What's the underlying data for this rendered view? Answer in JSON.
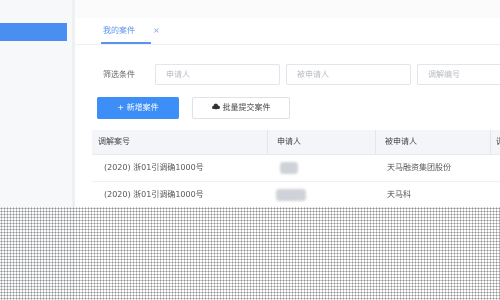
{
  "tabs": {
    "active_label": "我的案件",
    "close_glyph": "×"
  },
  "filter": {
    "label": "筛选条件",
    "applicant_placeholder": "申请人",
    "respondent_placeholder": "被申请人",
    "case_no_placeholder": "调解编号"
  },
  "actions": {
    "new_case_label": "+ 新增案件",
    "batch_submit_label": "批量提交案件",
    "batch_icon": "cloud-upload-icon"
  },
  "table": {
    "headers": [
      "调解案号",
      "申请人",
      "被申请人",
      "调"
    ],
    "rows": [
      {
        "case_no": "(2020) 浙01引调确1000号",
        "respondent": "天马融资集团股份"
      },
      {
        "case_no": "(2020) 浙01引调确1000号",
        "respondent": "天马科"
      }
    ]
  },
  "colors": {
    "primary": "#3e8ef7",
    "sidebar_active": "#4b8ef1",
    "tab_active": "#5a93ea"
  }
}
